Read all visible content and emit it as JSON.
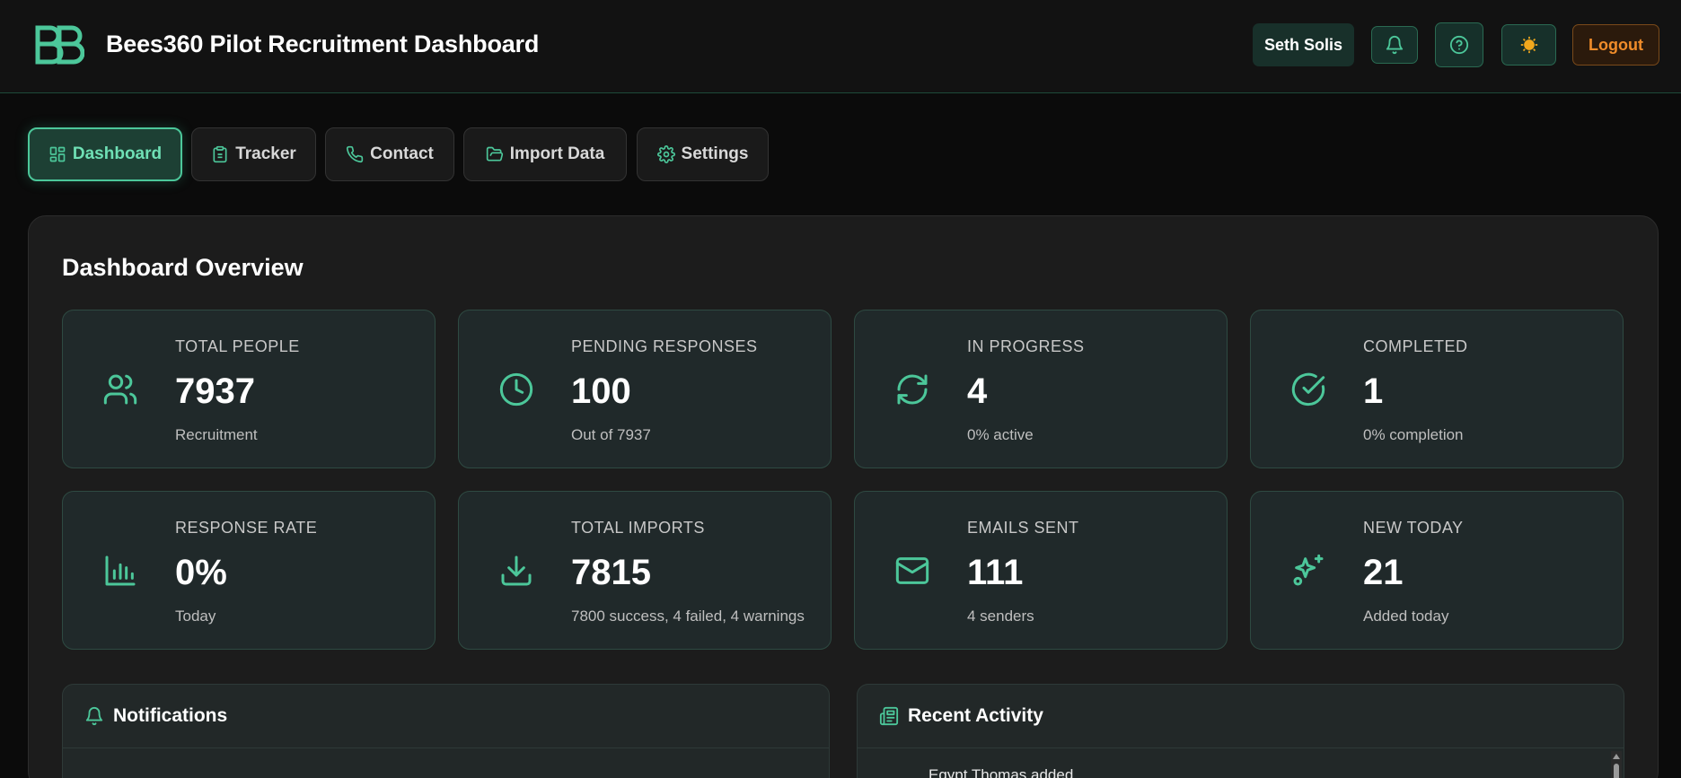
{
  "header": {
    "title": "Bees360 Pilot Recruitment Dashboard",
    "user_name": "Seth Solis",
    "logout_label": "Logout",
    "icons": [
      "logo-icon",
      "bell-icon",
      "help-icon",
      "sun-icon"
    ]
  },
  "tabs": [
    {
      "label": "Dashboard",
      "icon": "dashboard-icon",
      "active": true
    },
    {
      "label": "Tracker",
      "icon": "clipboard-icon",
      "active": false
    },
    {
      "label": "Contact",
      "icon": "phone-icon",
      "active": false
    },
    {
      "label": "Import Data",
      "icon": "folder-open-icon",
      "active": false
    },
    {
      "label": "Settings",
      "icon": "gear-icon",
      "active": false
    }
  ],
  "overview": {
    "title": "Dashboard Overview",
    "cards": [
      {
        "label": "TOTAL PEOPLE",
        "value": "7937",
        "sub": "Recruitment",
        "icon": "users-icon"
      },
      {
        "label": "PENDING RESPONSES",
        "value": "100",
        "sub": "Out of 7937",
        "icon": "clock-icon"
      },
      {
        "label": "IN PROGRESS",
        "value": "4",
        "sub": "0% active",
        "icon": "refresh-icon"
      },
      {
        "label": "COMPLETED",
        "value": "1",
        "sub": "0% completion",
        "icon": "check-circle-icon"
      },
      {
        "label": "RESPONSE RATE",
        "value": "0%",
        "sub": "Today",
        "icon": "bar-chart-icon"
      },
      {
        "label": "TOTAL IMPORTS",
        "value": "7815",
        "sub": "7800 success, 4 failed, 4 warnings",
        "icon": "download-icon"
      },
      {
        "label": "EMAILS SENT",
        "value": "111",
        "sub": "4 senders",
        "icon": "mail-icon"
      },
      {
        "label": "NEW TODAY",
        "value": "21",
        "sub": "Added today",
        "icon": "sparkles-icon"
      }
    ]
  },
  "notifications": {
    "title": "Notifications",
    "icon": "bell-icon"
  },
  "recent_activity": {
    "title": "Recent Activity",
    "icon": "newspaper-icon",
    "items": [
      "Egypt Thomas added"
    ]
  },
  "colors": {
    "accent": "#4cc79a",
    "background": "#0b0b0b",
    "card": "#20292a",
    "logout": "#f08c2a"
  }
}
